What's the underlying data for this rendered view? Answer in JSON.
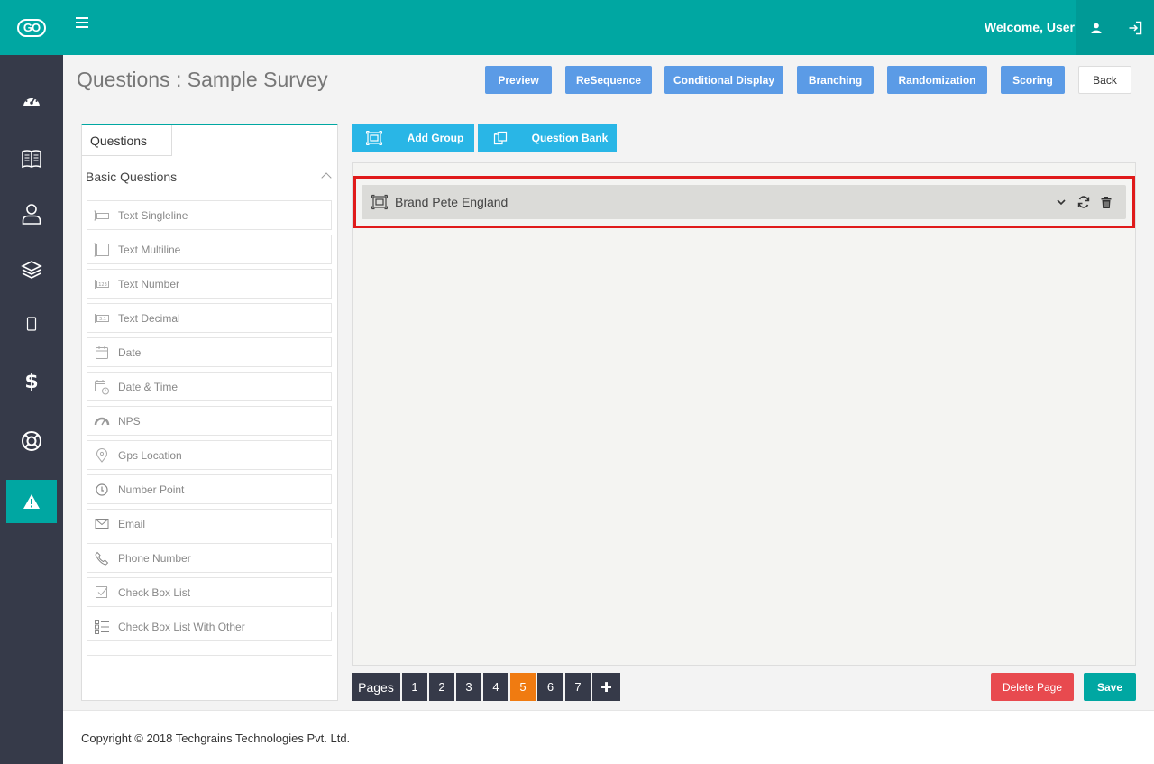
{
  "app": {
    "logo_text": "GO",
    "welcome": "Welcome, User"
  },
  "header": {
    "title": "Questions : Sample Survey",
    "buttons": {
      "preview": "Preview",
      "resequence": "ReSequence",
      "conditional_display": "Conditional Display",
      "branching": "Branching",
      "randomization": "Randomization",
      "scoring": "Scoring",
      "back": "Back"
    }
  },
  "left_panel": {
    "tab": "Questions",
    "section": "Basic Questions",
    "items": [
      {
        "label": "Text Singleline",
        "icon": "text-singleline-icon"
      },
      {
        "label": "Text Multiline",
        "icon": "text-multiline-icon"
      },
      {
        "label": "Text Number",
        "icon": "text-number-icon"
      },
      {
        "label": "Text Decimal",
        "icon": "text-decimal-icon"
      },
      {
        "label": "Date",
        "icon": "calendar-icon"
      },
      {
        "label": "Date & Time",
        "icon": "calendar-clock-icon"
      },
      {
        "label": "NPS",
        "icon": "gauge-icon"
      },
      {
        "label": "Gps Location",
        "icon": "map-pin-icon"
      },
      {
        "label": "Number Point",
        "icon": "number-point-icon"
      },
      {
        "label": "Email",
        "icon": "envelope-icon"
      },
      {
        "label": "Phone Number",
        "icon": "phone-icon"
      },
      {
        "label": "Check Box List",
        "icon": "checkbox-icon"
      },
      {
        "label": "Check Box List With Other",
        "icon": "checklist-icon"
      }
    ]
  },
  "actions": {
    "add_group": "Add Group",
    "question_bank": "Question Bank"
  },
  "group": {
    "title": "Brand Pete England"
  },
  "pagination": {
    "label": "Pages",
    "pages": [
      "1",
      "2",
      "3",
      "4",
      "5",
      "6",
      "7"
    ],
    "active": "5",
    "add": "✚"
  },
  "page_actions": {
    "delete": "Delete Page",
    "save": "Save"
  },
  "footer": {
    "copyright": "Copyright © 2018 Techgrains Technologies Pvt. Ltd."
  },
  "colors": {
    "brand": "#00a7a2",
    "sidebar": "#363a49",
    "toolbar_button": "#5b9be6",
    "action_button": "#29b6e6",
    "active_page": "#f07b11",
    "danger": "#e84a4f",
    "highlight": "#e01a1a"
  }
}
